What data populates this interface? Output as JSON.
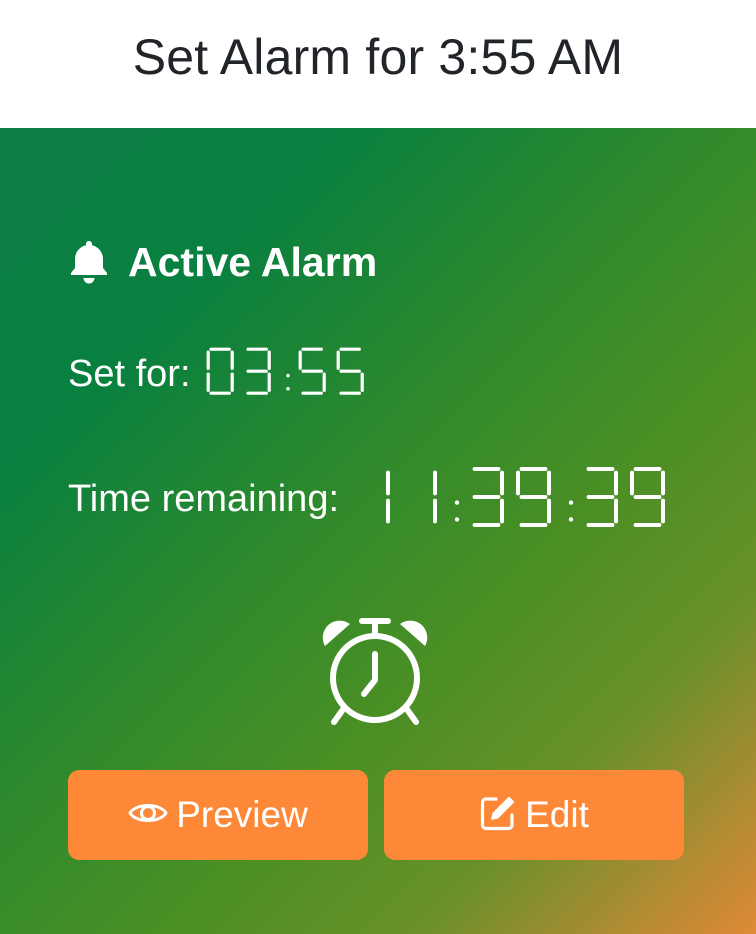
{
  "header": {
    "title": "Set Alarm for 3:55 AM"
  },
  "alarm": {
    "title": "Active Alarm",
    "set_for_label": "Set for:",
    "set_for_value": "03:55",
    "remaining_label": "Time remaining:",
    "remaining_value": "11:39:39"
  },
  "actions": {
    "preview_label": "Preview",
    "edit_label": "Edit"
  },
  "icons": {
    "bell": "bell-icon",
    "alarm_clock": "alarm-clock-icon",
    "preview": "eye-icon",
    "edit": "edit-icon"
  },
  "colors": {
    "button": "#fd8838",
    "gradient_start": "#0e7d46",
    "gradient_end": "#e08a36",
    "title_text": "#212529"
  }
}
